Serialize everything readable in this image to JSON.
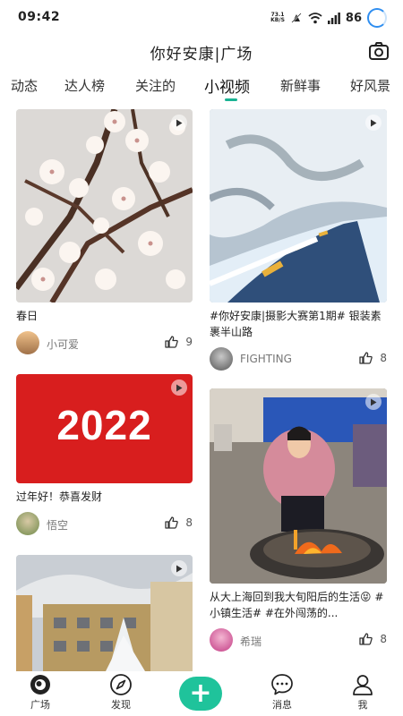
{
  "status_bar": {
    "time": "09:42",
    "net_speed_value": "73.1",
    "net_speed_unit": "KB/S",
    "battery": "86"
  },
  "header": {
    "title": "你好安康|广场"
  },
  "tabs": [
    {
      "label": "动态"
    },
    {
      "label": "达人榜"
    },
    {
      "label": "关注的"
    },
    {
      "label": "小视频",
      "active": true
    },
    {
      "label": "新鲜事"
    },
    {
      "label": "好风景"
    }
  ],
  "feed": {
    "left": [
      {
        "title": "春日",
        "author": "小可爱",
        "likes": "9"
      },
      {
        "title": "过年好！恭喜发财",
        "author": "悟空",
        "likes": "8",
        "banner_text": "2022"
      },
      {
        "title": "",
        "author": "",
        "likes": ""
      }
    ],
    "right": [
      {
        "title": "#你好安康|摄影大赛第1期# 银装素裹半山路",
        "author": "FIGHTING",
        "likes": "8"
      },
      {
        "title": "从大上海回到我大旬阳后的生活😝 #小镇生活# #在外闯荡的...",
        "author": "希瑞",
        "likes": "8"
      }
    ]
  },
  "bottom_nav": {
    "items": [
      {
        "label": "广场"
      },
      {
        "label": "发现"
      },
      {
        "label": "消息"
      },
      {
        "label": "我"
      }
    ],
    "add_symbol": "+"
  },
  "colors": {
    "accent": "#1ab394",
    "add_button": "#1fc39b",
    "banner_red": "#d81e1e"
  }
}
